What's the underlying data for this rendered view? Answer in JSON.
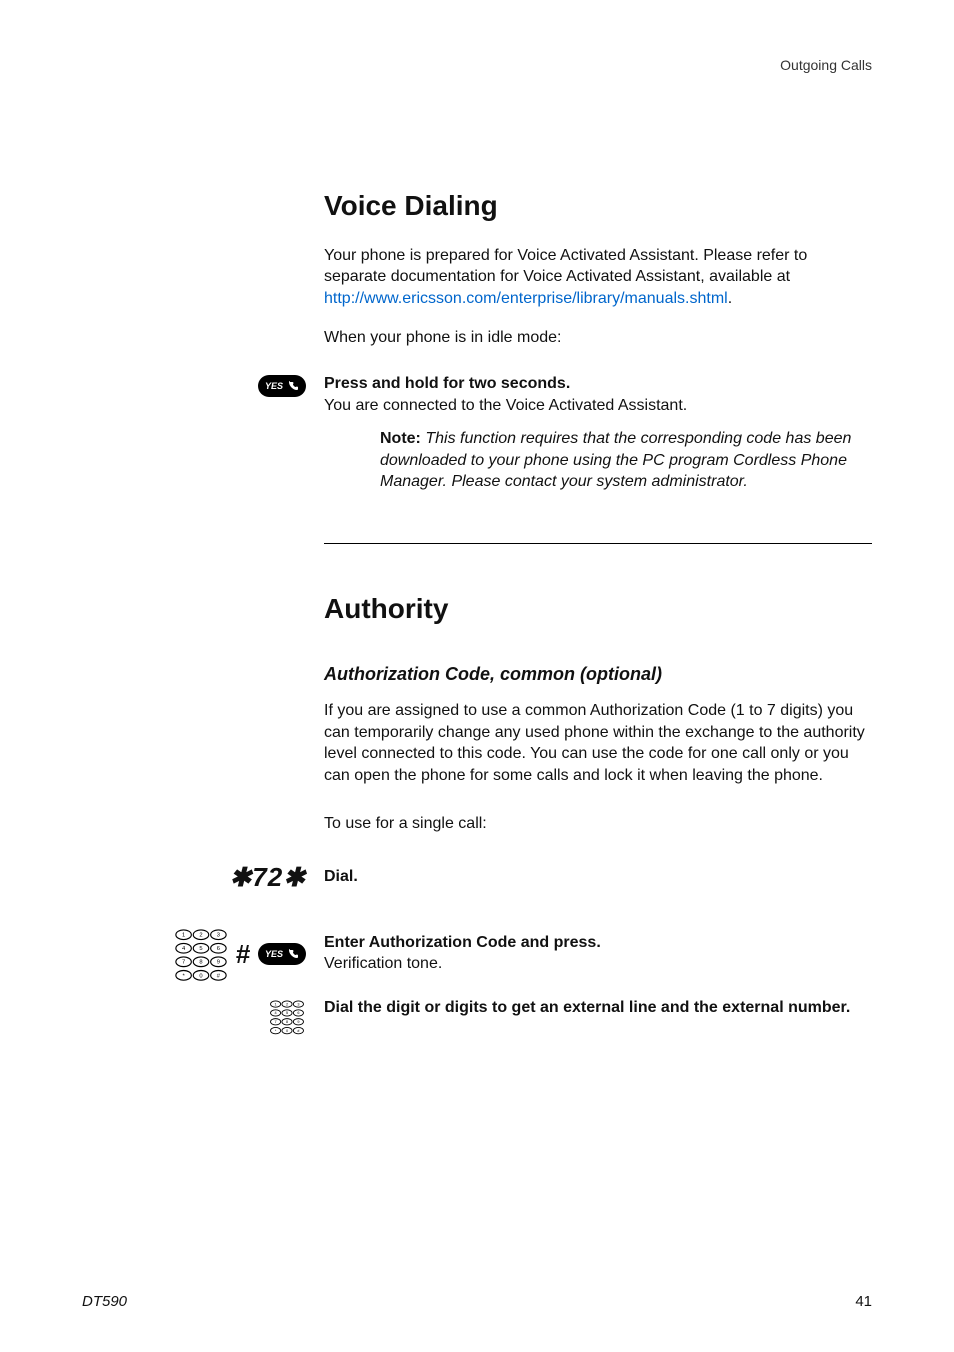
{
  "running_head": "Outgoing Calls",
  "section1": {
    "heading": "Voice Dialing",
    "intro_part1": "Your phone is prepared for Voice Activated Assistant. Please refer to separate documentation for Voice Activated Assistant, available at ",
    "intro_link": "http://www.ericsson.com/enterprise/library/manuals.shtml",
    "intro_part2": ".",
    "idle_line": "When your phone is in idle mode:",
    "press_hold_title": "Press and hold for two seconds.",
    "press_hold_sub": "You are connected to the Voice Activated Assistant.",
    "note_label": "Note:",
    "note_body": " This function requires that the corresponding code has been downloaded to your phone using the PC program Cordless Phone Manager. Please contact your system administrator."
  },
  "section2": {
    "heading": "Authority",
    "subheading": "Authorization Code, common (optional)",
    "body": "If you are assigned to use a common Authorization Code (1 to 7 digits) you can temporarily change any used phone within the exchange to the authority level connected to this code. You can use the code for one call only or you can open the phone for some calls and lock it when leaving the phone.",
    "single_call_intro": "To use for a single call:",
    "dial_code": "✱72✱",
    "dial_label": "Dial.",
    "enter_code_title": "Enter Authorization Code and press.",
    "enter_code_sub": "Verification tone.",
    "external_line": "Dial the digit or digits to get an external line and the external number."
  },
  "icons": {
    "yes_label": "YES"
  },
  "footer": {
    "model": "DT590",
    "page": "41"
  }
}
